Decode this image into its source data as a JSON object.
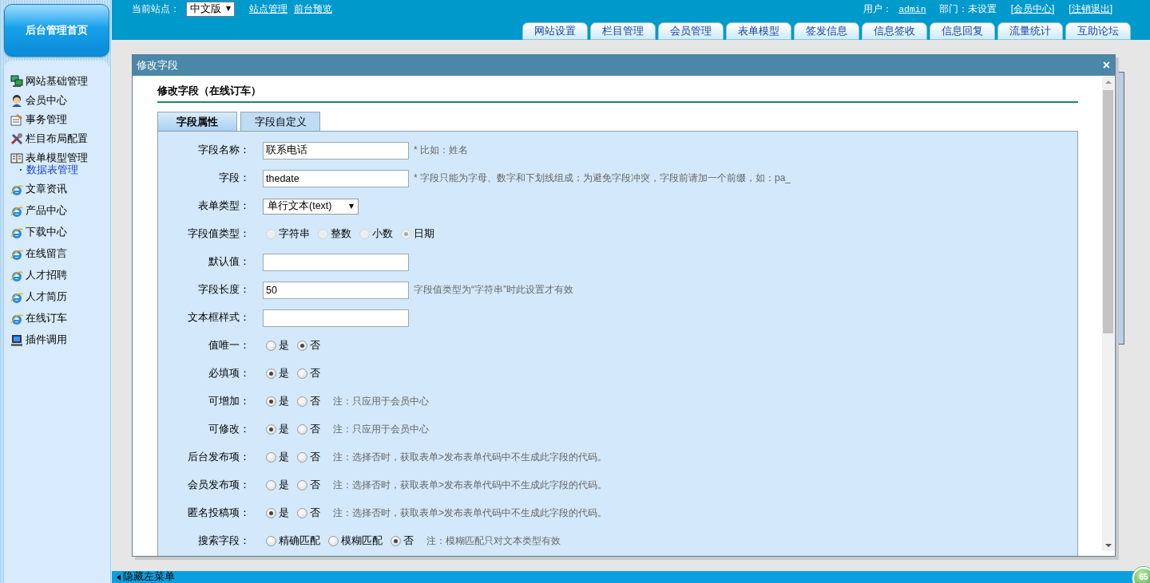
{
  "sidebar": {
    "home_button": "后台管理首页",
    "items": [
      {
        "label": "网站基础管理",
        "kind": "section",
        "selected": false
      },
      {
        "label": "会员中心",
        "kind": "section",
        "selected": false
      },
      {
        "label": "事务管理",
        "kind": "section",
        "selected": false
      },
      {
        "label": "栏目布局配置",
        "kind": "section",
        "selected": false
      },
      {
        "label": "表单模型管理",
        "kind": "section",
        "selected": false,
        "children": [
          {
            "label": "数据表管理",
            "selected": true
          }
        ]
      },
      {
        "label": "文章资讯",
        "kind": "link",
        "selected": false
      },
      {
        "label": "产品中心",
        "kind": "link",
        "selected": false
      },
      {
        "label": "下载中心",
        "kind": "link",
        "selected": false
      },
      {
        "label": "在线留言",
        "kind": "link",
        "selected": false
      },
      {
        "label": "人才招聘",
        "kind": "link",
        "selected": false
      },
      {
        "label": "人才简历",
        "kind": "link",
        "selected": false
      },
      {
        "label": "在线订车",
        "kind": "link",
        "selected": false
      },
      {
        "label": "插件调用",
        "kind": "plugin",
        "selected": false
      }
    ]
  },
  "header": {
    "site_label": "当前站点：",
    "site_select": "中文版",
    "links": [
      "站点管理",
      "前台预览"
    ],
    "user_label": "用户：",
    "user": "admin",
    "dept": "部门：未设置",
    "right_links": [
      "[会员中心]",
      "[注销退出]"
    ],
    "tabs": [
      {
        "label": "网站设置",
        "selected": false
      },
      {
        "label": "栏目管理",
        "selected": false
      },
      {
        "label": "会员管理",
        "selected": false
      },
      {
        "label": "表单模型",
        "selected": false
      },
      {
        "label": "签发信息",
        "selected": false
      },
      {
        "label": "信息签收",
        "selected": false
      },
      {
        "label": "信息回复",
        "selected": false
      },
      {
        "label": "流量统计",
        "selected": false
      },
      {
        "label": "互助论坛",
        "selected": false
      }
    ]
  },
  "dialog": {
    "title": "修改字段",
    "close": "×",
    "heading": "修改字段（在线订车）",
    "tabs": [
      {
        "label": "字段属性",
        "selected": true
      },
      {
        "label": "字段自定义",
        "selected": false
      }
    ],
    "rows": [
      {
        "kind": "text",
        "label": "字段名称：",
        "value": "联系电话",
        "note": "* 比如：姓名"
      },
      {
        "kind": "text",
        "label": "字段：",
        "value": "thedate",
        "note": "* 字段只能为字母、数字和下划线组成；为避免字段冲突，字段前请加一个前缀，如：pa_"
      },
      {
        "kind": "select",
        "label": "表单类型：",
        "value": "单行文本(text)"
      },
      {
        "kind": "radio",
        "label": "字段值类型：",
        "disabled": true,
        "options": [
          {
            "label": "字符串",
            "selected": false
          },
          {
            "label": "整数",
            "selected": false
          },
          {
            "label": "小数",
            "selected": false
          },
          {
            "label": "日期",
            "selected": true
          }
        ]
      },
      {
        "kind": "text",
        "label": "默认值："
      },
      {
        "kind": "text",
        "label": "字段长度：",
        "value": "50",
        "note": "字段值类型为“字符串”时此设置才有效"
      },
      {
        "kind": "text",
        "label": "文本框样式："
      },
      {
        "kind": "radio",
        "label": "值唯一：",
        "disabled": false,
        "options": [
          {
            "label": "是",
            "selected": false
          },
          {
            "label": "否",
            "selected": true
          }
        ]
      },
      {
        "kind": "radio",
        "label": "必填项：",
        "disabled": false,
        "options": [
          {
            "label": "是",
            "selected": true
          },
          {
            "label": "否",
            "selected": false
          }
        ]
      },
      {
        "kind": "radio",
        "label": "可增加：",
        "disabled": false,
        "options": [
          {
            "label": "是",
            "selected": true
          },
          {
            "label": "否",
            "selected": false
          }
        ],
        "note": "注：只应用于会员中心"
      },
      {
        "kind": "radio",
        "label": "可修改：",
        "disabled": false,
        "options": [
          {
            "label": "是",
            "selected": true
          },
          {
            "label": "否",
            "selected": false
          }
        ],
        "note": "注：只应用于会员中心"
      },
      {
        "kind": "radio",
        "label": "后台发布项：",
        "disabled": false,
        "options": [
          {
            "label": "是",
            "selected": false
          },
          {
            "label": "否",
            "selected": false
          }
        ],
        "note": "注：选择否时，获取表单>发布表单代码中不生成此字段的代码。"
      },
      {
        "kind": "radio",
        "label": "会员发布项：",
        "disabled": false,
        "options": [
          {
            "label": "是",
            "selected": false
          },
          {
            "label": "否",
            "selected": false
          }
        ],
        "note": "注：选择否时，获取表单>发布表单代码中不生成此字段的代码。"
      },
      {
        "kind": "radio",
        "label": "匿名投稿项：",
        "disabled": false,
        "options": [
          {
            "label": "是",
            "selected": true
          },
          {
            "label": "否",
            "selected": false
          }
        ],
        "note": "注：选择否时，获取表单>发布表单代码中不生成此字段的代码。"
      },
      {
        "kind": "radio",
        "label": "搜索字段：",
        "disabled": false,
        "options": [
          {
            "label": "精确匹配",
            "selected": false
          },
          {
            "label": "模糊匹配",
            "selected": false
          },
          {
            "label": "否",
            "selected": true
          }
        ],
        "note": "注：模糊匹配只对文本类型有效"
      }
    ]
  },
  "footer": {
    "toggle": "隐藏左菜单",
    "badge": "65"
  }
}
